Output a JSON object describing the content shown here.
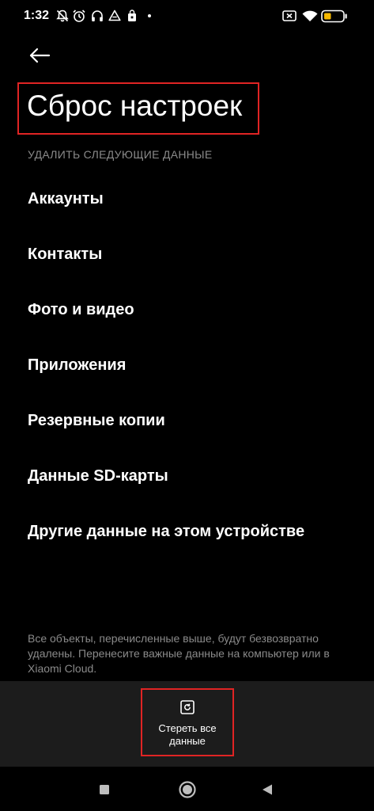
{
  "status_bar": {
    "time": "1:32",
    "icons": [
      "notifications-off-icon",
      "alarm-icon",
      "headphones-icon",
      "drive-icon",
      "shopping-bag-icon",
      "dot-icon",
      "sim-off-icon",
      "wifi-icon",
      "battery-icon"
    ],
    "battery_color": "#f5b800"
  },
  "header": {
    "back_icon": "arrow-left-icon",
    "title": "Сброс настроек"
  },
  "section": {
    "header": "УДАЛИТЬ СЛЕДУЮЩИЕ ДАННЫЕ",
    "items": [
      {
        "label": "Аккаунты"
      },
      {
        "label": "Контакты"
      },
      {
        "label": "Фото и видео"
      },
      {
        "label": "Приложения"
      },
      {
        "label": "Резервные копии"
      },
      {
        "label": "Данные SD-карты"
      },
      {
        "label": "Другие данные на этом устройстве"
      }
    ]
  },
  "disclaimer": "Все объекты, перечисленные выше, будут безвозвратно удалены. Перенесите важные данные на компьютер или в Xiaomi Cloud.",
  "action": {
    "label": "Стереть все данные",
    "icon": "reset-icon"
  },
  "nav": {
    "icons": [
      "recents-icon",
      "home-icon",
      "back-icon"
    ]
  },
  "colors": {
    "highlight": "#e02424",
    "background": "#000000",
    "panel": "#1c1c1c",
    "secondary_text": "#8a8a8a"
  }
}
